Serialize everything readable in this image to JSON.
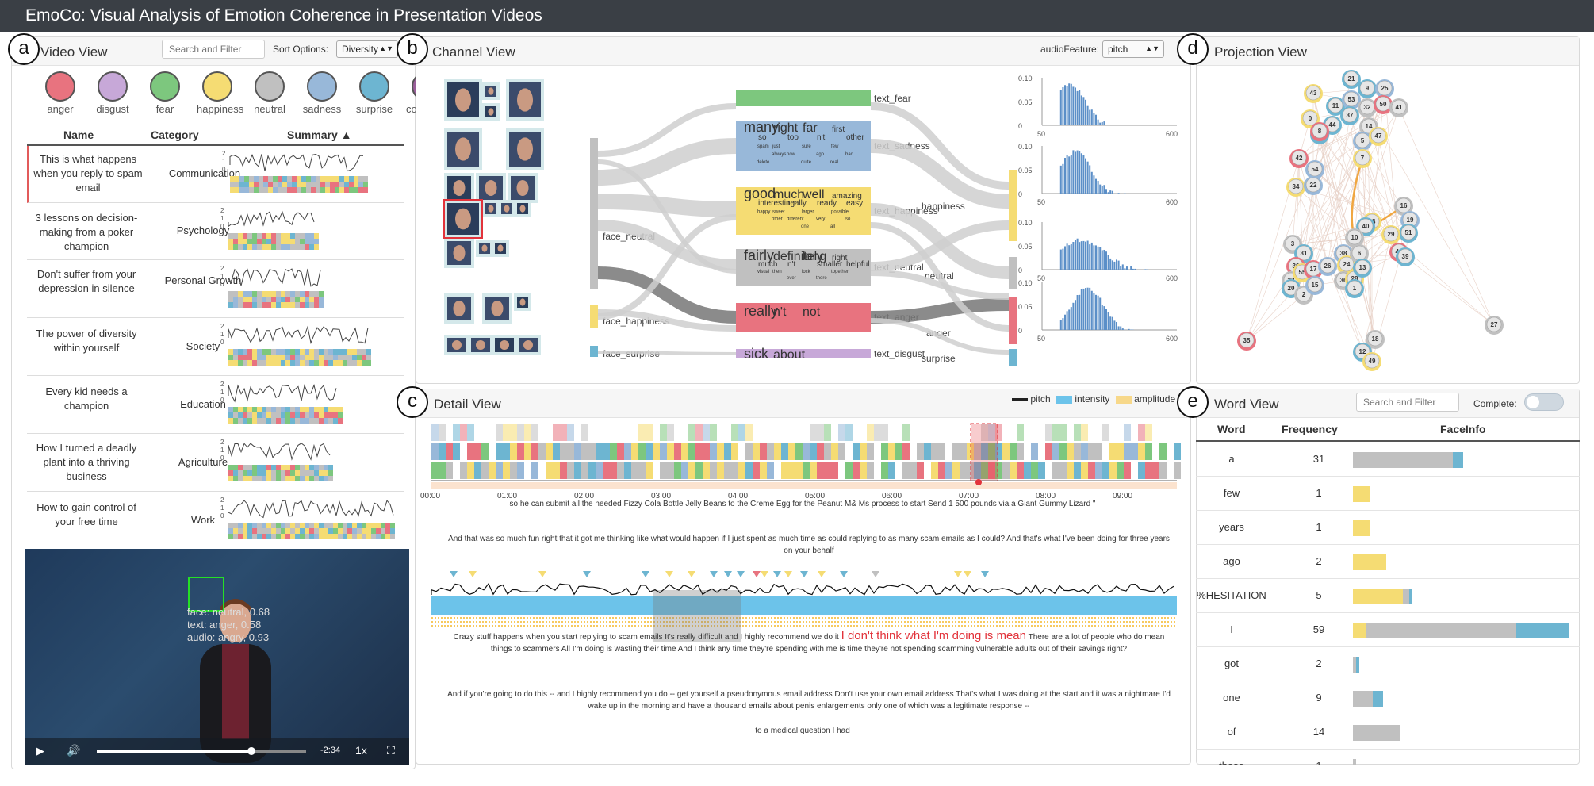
{
  "title": "EmoCo: Visual Analysis of Emotion Coherence in Presentation Videos",
  "markers": {
    "a": "a",
    "b": "b",
    "c": "c",
    "d": "d",
    "e": "e"
  },
  "colors": {
    "anger": "#e8737f",
    "disgust": "#c7a8d8",
    "fear": "#7dc77e",
    "happiness": "#f5dc73",
    "neutral": "#c0c0c0",
    "sadness": "#98b8d9",
    "surprise": "#6db5d1",
    "contempt": "#9b5f9b",
    "titlebar": "#3a3f45",
    "accent_red": "#e2333b",
    "orange_line": "#f0a640"
  },
  "video_view": {
    "title": "Video View",
    "search_placeholder": "Search and Filter",
    "sort_label": "Sort Options:",
    "sort_value": "Diversity",
    "emotions": [
      "anger",
      "disgust",
      "fear",
      "happiness",
      "neutral",
      "sadness",
      "surprise",
      "contempt"
    ],
    "columns": {
      "name": "Name",
      "category": "Category",
      "summary": "Summary ▲"
    },
    "rows": [
      {
        "name": "This is what happens when you reply to spam email",
        "category": "Communication"
      },
      {
        "name": "3 lessons on decision-making from a poker champion",
        "category": "Psychology"
      },
      {
        "name": "Don't suffer from your depression in silence",
        "category": "Personal Growth"
      },
      {
        "name": "The power of diversity within yourself",
        "category": "Society"
      },
      {
        "name": "Every kid needs a champion",
        "category": "Education"
      },
      {
        "name": "How I turned a deadly plant into a thriving business",
        "category": "Agriculture"
      },
      {
        "name": "How to gain control of your free time",
        "category": "Work"
      }
    ],
    "axis_ticks": [
      "2",
      "1",
      "0"
    ],
    "player": {
      "overlay": [
        "face: neutral, 0.68",
        "text: anger, 0.58",
        "audio: angry, 0.93"
      ],
      "time": "-2:34",
      "speed": "1x",
      "progress": 0.67
    }
  },
  "channel_view": {
    "title": "Channel View",
    "audio_feature_label": "audioFeature:",
    "audio_feature_value": "pitch",
    "face_nodes": [
      "face_neutral",
      "face_happiness",
      "face_surprise"
    ],
    "text_nodes": [
      "text_fear",
      "text_sadness",
      "text_happiness",
      "text_neutral",
      "text_anger",
      "text_disgust"
    ],
    "audio_nodes": [
      "happiness",
      "neutral",
      "anger",
      "surprise"
    ],
    "hist_y": [
      "0.10",
      "0.05",
      "0"
    ],
    "hist_x": [
      "50",
      "600"
    ],
    "word_clouds": {
      "sadness": [
        "many",
        "right",
        "far",
        "first",
        "so",
        "too",
        "n't",
        "other",
        "just",
        "sure",
        "few",
        "spam",
        "now",
        "ago",
        "bad",
        "always",
        "quite",
        "real",
        "delete"
      ],
      "happiness": [
        "good",
        "much",
        "well",
        "amazing",
        "interesting",
        "really",
        "ready",
        "easy",
        "sweet",
        "larger",
        "possible",
        "happy",
        "different",
        "very",
        "so",
        "other",
        "one",
        "all"
      ],
      "neutral": [
        "fairly",
        "definitely",
        "long",
        "right",
        "much",
        "n't",
        "smaller",
        "helpful",
        "then",
        "lock",
        "together",
        "visual",
        "ever",
        "there"
      ],
      "anger": [
        "really",
        "n't",
        "not"
      ],
      "disgust": [
        "sick",
        "about"
      ]
    }
  },
  "projection_view": {
    "title": "Projection View",
    "nodes": [
      "21",
      "9",
      "25",
      "43",
      "11",
      "53",
      "32",
      "50",
      "41",
      "0",
      "44",
      "4",
      "37",
      "14",
      "5",
      "47",
      "8",
      "7",
      "42",
      "54",
      "34",
      "22",
      "16",
      "19",
      "51",
      "29",
      "46",
      "39",
      "48",
      "40",
      "10",
      "3",
      "31",
      "30",
      "23",
      "55",
      "20",
      "17",
      "2",
      "15",
      "38",
      "26",
      "24",
      "36",
      "28",
      "6",
      "13",
      "1",
      "35",
      "27",
      "18",
      "12",
      "49"
    ]
  },
  "detail_view": {
    "title": "Detail View",
    "legend": [
      "pitch",
      "intensity",
      "amplitude"
    ],
    "time_ticks": [
      "00:00",
      "01:00",
      "02:00",
      "03:00",
      "04:00",
      "05:00",
      "06:00",
      "07:00",
      "08:00",
      "09:00"
    ],
    "transcript": [
      "so he can submit all the needed Fizzy Cola Bottle Jelly Beans to the Creme Egg for the Peanut M& Ms process to start Send 1 500 pounds via a Giant Gummy Lizard \"",
      "And that was so much fun right that it got me thinking like what would happen if I just spent as much time as could replying to as many scam emails as I could? And that's what I've been doing for three years on your behalf",
      "Crazy stuff happens when you start replying to scam emails It's really difficult and I highly recommend we do it",
      "I don't think what I'm doing is mean",
      "There are a lot of people who do mean things to scammers All I'm doing is wasting their time And I think any time they're spending with me is time they're not spending scamming vulnerable adults out of their savings right?",
      "And if you're going to do this -- and I highly recommend you do -- get yourself a pseudonymous email address Don't use your own email address That's what I was doing at the start and it was a nightmare I'd wake up in the morning and have a thousand emails about penis enlargements only one of which was a legitimate response --",
      "to a medical question I had"
    ]
  },
  "word_view": {
    "title": "Word View",
    "search_placeholder": "Search and Filter",
    "complete_label": "Complete:",
    "columns": {
      "word": "Word",
      "frequency": "Frequency",
      "faceinfo": "FaceInfo"
    },
    "rows": [
      {
        "word": "a",
        "frequency": "31",
        "neutral": 30,
        "surprise": 3
      },
      {
        "word": "few",
        "frequency": "1",
        "happiness": 1
      },
      {
        "word": "years",
        "frequency": "1",
        "happiness": 1
      },
      {
        "word": "ago",
        "frequency": "2",
        "happiness": 2
      },
      {
        "word": "%HESITATION",
        "frequency": "5",
        "happiness": 3,
        "neutral": 2,
        "surprise": 0.5
      },
      {
        "word": "I",
        "frequency": "59",
        "neutral": 45,
        "surprise": 16,
        "happiness": 4
      },
      {
        "word": "got",
        "frequency": "2",
        "neutral": 1,
        "surprise": 1
      },
      {
        "word": "one",
        "frequency": "9",
        "neutral": 6,
        "surprise": 3
      },
      {
        "word": "of",
        "frequency": "14",
        "neutral": 14
      },
      {
        "word": "those",
        "frequency": "1",
        "neutral": 1
      }
    ]
  }
}
